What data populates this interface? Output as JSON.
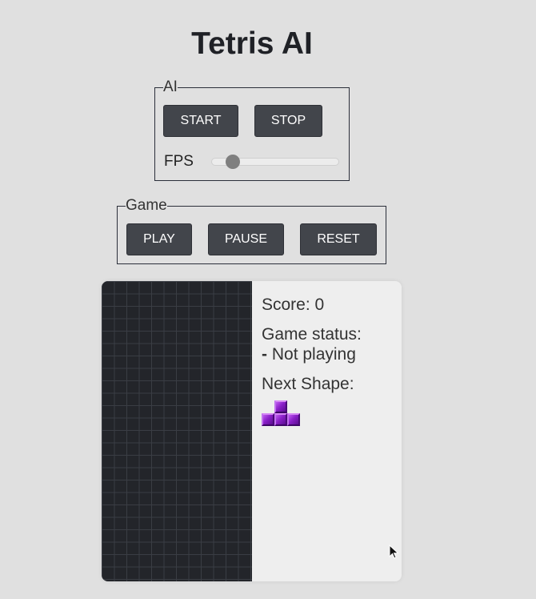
{
  "title": "Tetris AI",
  "ai_panel": {
    "legend": "AI",
    "start_label": "START",
    "stop_label": "STOP",
    "fps_label": "FPS",
    "fps_level": 0.13
  },
  "game_panel": {
    "legend": "Game",
    "play_label": "PLAY",
    "pause_label": "PAUSE",
    "reset_label": "RESET"
  },
  "info": {
    "score_text": "Score: 0",
    "status_title": "Game status:",
    "status_dash": "-",
    "status_value": "Not playing",
    "next_shape_title": "Next Shape:",
    "next_shape": "T-piece",
    "next_shape_color": "#8a1fc8"
  },
  "board": {
    "background": "#23252a",
    "grid_color": "#3a3d44"
  },
  "colors": {
    "button_bg": "#42454b",
    "page_bg": "#e0e0e0"
  }
}
